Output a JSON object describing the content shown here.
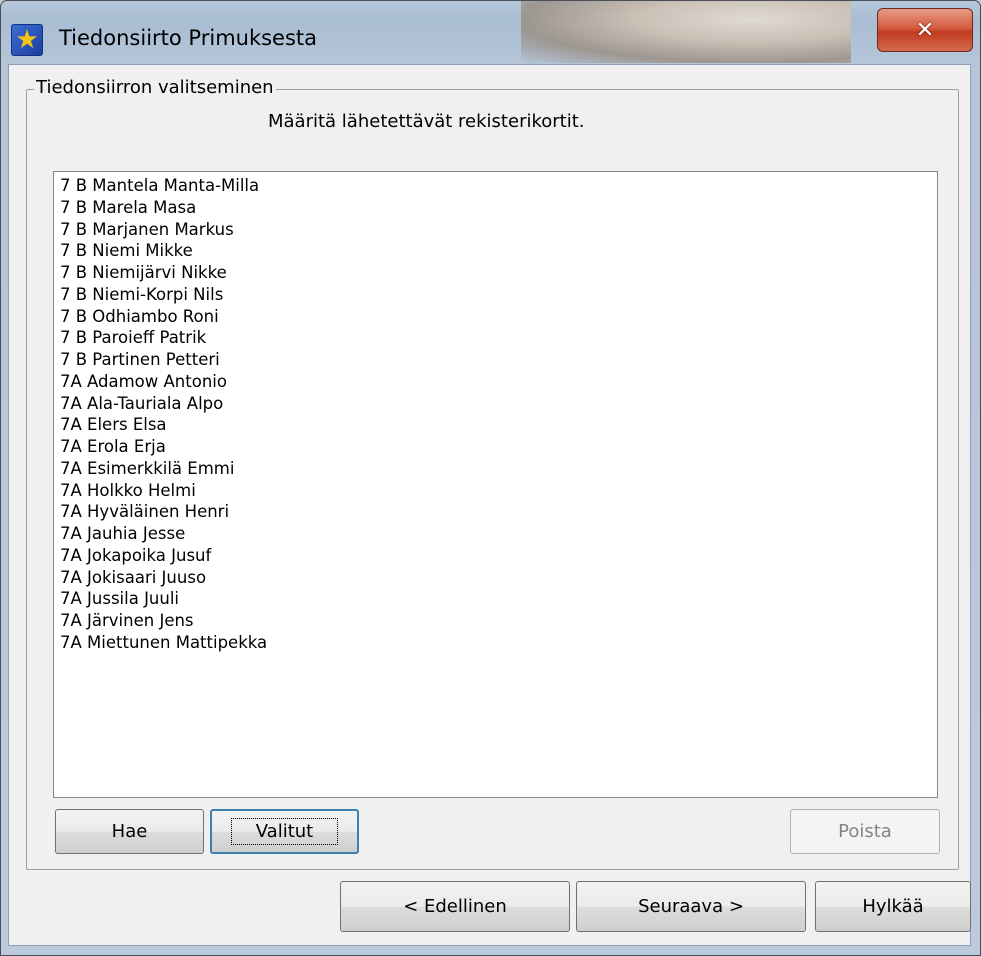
{
  "window": {
    "title": "Tiedonsiirto Primuksesta",
    "close_glyph": "✕"
  },
  "group": {
    "legend": "Tiedonsiirron valitseminen",
    "instruction": "Määritä lähetettävät rekisterikortit."
  },
  "list": {
    "items": [
      "7 B Mantela Manta-Milla",
      "7 B Marela Masa",
      "7 B Marjanen Markus",
      "7 B Niemi Mikke",
      "7 B Niemijärvi Nikke",
      "7 B Niemi-Korpi Nils",
      "7 B Odhiambo Roni",
      "7 B Paroieff Patrik",
      "7 B Partinen Petteri",
      "7A Adamow Antonio",
      "7A Ala-Tauriala Alpo",
      "7A Elers Elsa",
      "7A Erola Erja",
      "7A Esimerkkilä Emmi",
      "7A Holkko Helmi",
      "7A Hyväläinen Henri",
      "7A Jauhia Jesse",
      "7A Jokapoika Jusuf",
      "7A Jokisaari Juuso",
      "7A Jussila Juuli",
      "7A Järvinen Jens",
      "7A Miettunen Mattipekka"
    ]
  },
  "buttons": {
    "hae": "Hae",
    "valitut": "Valitut",
    "poista": "Poista",
    "edellinen": "< Edellinen",
    "seuraava": "Seuraava >",
    "hylkaa": "Hylkää"
  },
  "icons": {
    "app": "star-icon",
    "close": "close-icon"
  },
  "colors": {
    "close_button": "#c13b1f",
    "app_icon": "#1d3e9c",
    "star": "#f4c21b"
  }
}
